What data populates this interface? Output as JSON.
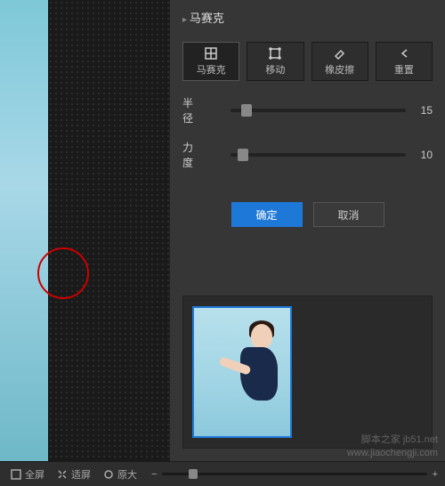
{
  "panel": {
    "title": "马赛克",
    "tools": {
      "mosaic": "马赛克",
      "move": "移动",
      "eraser": "橡皮擦",
      "reset": "重置"
    },
    "sliders": {
      "radius": {
        "label": "半径",
        "value": "15"
      },
      "strength": {
        "label": "力度",
        "value": "10"
      }
    },
    "buttons": {
      "ok": "确定",
      "cancel": "取消"
    }
  },
  "statusbar": {
    "fullscreen": "全屏",
    "fit": "适屏",
    "original": "原大",
    "zoom_minus": "−",
    "zoom_plus": "+"
  },
  "watermark": {
    "line1": "脚本之家 jb51.net",
    "line2": "www.jiaochengji.com"
  },
  "icons": {
    "mosaic": "mosaic-icon",
    "move": "move-icon",
    "eraser": "eraser-icon",
    "reset": "reset-icon",
    "fullscreen": "fullscreen-icon",
    "fit": "fit-icon",
    "original": "original-icon"
  }
}
